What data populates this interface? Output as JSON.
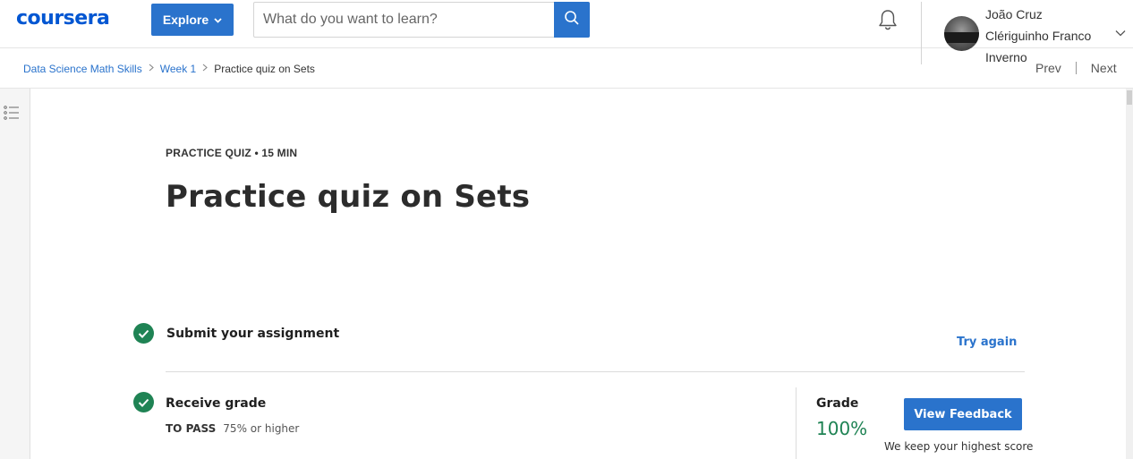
{
  "header": {
    "logo_text": "coursera",
    "explore_label": "Explore",
    "search_placeholder": "What do you want to learn?",
    "user_name": "João Cruz Clériguinho Franco Inverno"
  },
  "breadcrumb": {
    "items": [
      "Data Science Math Skills",
      "Week 1"
    ],
    "current": "Practice quiz on Sets"
  },
  "nav": {
    "prev": "Prev",
    "next": "Next"
  },
  "quiz": {
    "meta": "PRACTICE QUIZ • 15 MIN",
    "title": "Practice quiz on Sets"
  },
  "steps": {
    "submit": {
      "title": "Submit your assignment",
      "action": "Try again"
    },
    "grade": {
      "title": "Receive grade",
      "to_pass_label": "TO PASS",
      "to_pass_value": "75% or higher",
      "grade_label": "Grade",
      "grade_value": "100%",
      "feedback_button": "View Feedback",
      "note": "We keep your highest score"
    }
  },
  "colors": {
    "accent": "#2a73cc",
    "brand": "#0056d2",
    "success": "#1f8354"
  },
  "icons": [
    "search-icon",
    "bell-icon",
    "chevron-down-icon",
    "list-icon",
    "check-icon"
  ]
}
